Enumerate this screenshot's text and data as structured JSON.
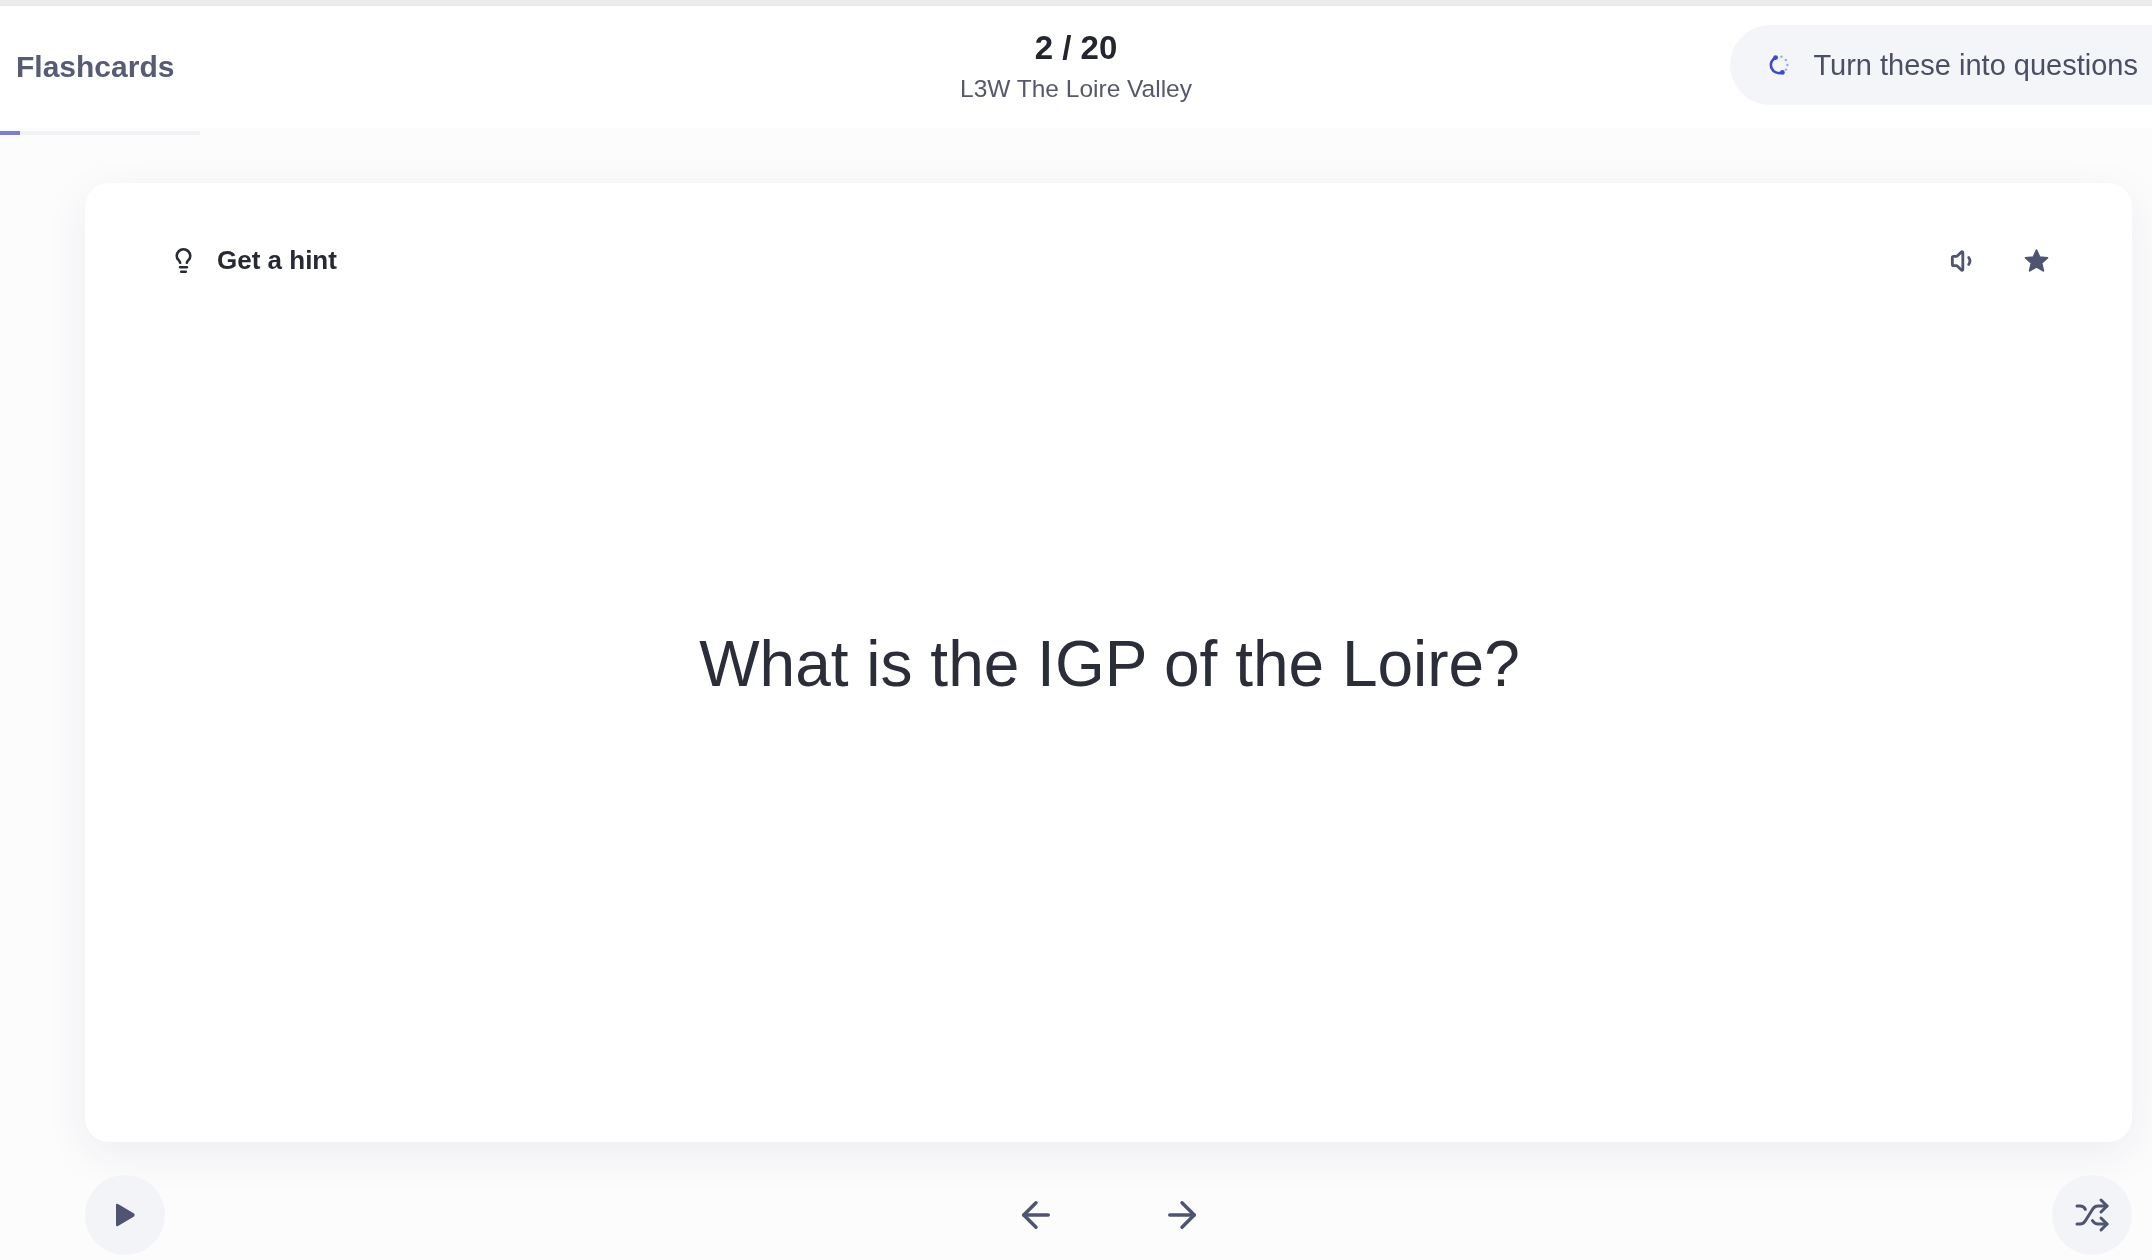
{
  "header": {
    "title": "Flashcards",
    "progress": {
      "level": 0.1
    },
    "counter": "2 / 20",
    "deck_title": "L3W The Loire Valley",
    "action_button": {
      "label": "Turn these into questions"
    }
  },
  "card": {
    "hint_button": {
      "label": "Get a hint"
    },
    "starred": true,
    "question": "What is the IGP of the Loire?"
  }
}
